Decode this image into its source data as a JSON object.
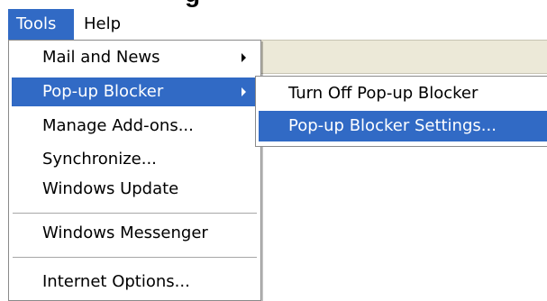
{
  "heading": {
    "text": "g"
  },
  "menubar": {
    "items": [
      {
        "label": "Tools",
        "active": true
      },
      {
        "label": "Help",
        "active": false
      }
    ]
  },
  "tools_menu": {
    "items": [
      {
        "label": "Mail and News",
        "has_submenu": true
      },
      {
        "label": "Pop-up Blocker",
        "has_submenu": true,
        "highlighted": true
      },
      {
        "label": "Manage Add-ons..."
      },
      {
        "label": "Synchronize..."
      },
      {
        "label": "Windows Update"
      },
      {
        "label": "Windows Messenger"
      },
      {
        "label": "Internet Options..."
      }
    ]
  },
  "popup_blocker_submenu": {
    "items": [
      {
        "label": "Turn Off Pop-up Blocker"
      },
      {
        "label": "Pop-up Blocker Settings...",
        "highlighted": true
      }
    ]
  },
  "colors": {
    "highlight": "#316ac5",
    "highlight_text": "#ffffff",
    "menu_background": "#ffffff",
    "toolbar_background": "#ece9d8",
    "border": "#8a8a8a",
    "text": "#000000"
  }
}
